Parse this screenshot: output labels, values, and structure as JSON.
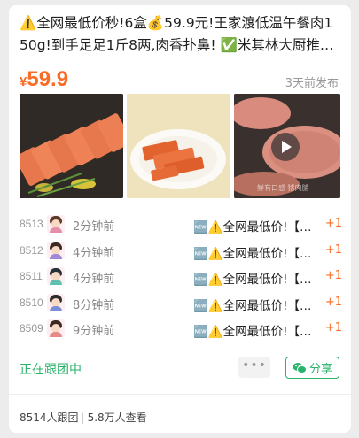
{
  "post": {
    "title": "⚠️全网最低价秒!6盒💰59.9元!王家渡低温午餐肉150g!到手足足1斤8两,肉香扑鼻! ✅米其林大厨推荐,中国十大火腿品牌之一……",
    "price_symbol": "¥",
    "price": "59.9",
    "posted": "3天前发布",
    "photo_watermark": "鲜有口感 猪肉脯"
  },
  "followers": [
    {
      "no": "8513",
      "time": "2分钟前",
      "text": "🆕⚠️全网最低价!【王家渡午餐肉】",
      "plus": "+1",
      "hair": "#5b3a2a",
      "body": "#e58fa8"
    },
    {
      "no": "8512",
      "time": "4分钟前",
      "text": "🆕⚠️全网最低价!【王家渡午餐肉】",
      "plus": "+1",
      "hair": "#3a2a22",
      "body": "#a08ad6"
    },
    {
      "no": "8511",
      "time": "4分钟前",
      "text": "🆕⚠️全网最低价!【王家渡午餐肉】",
      "plus": "+1",
      "hair": "#26323a",
      "body": "#5fc0b0"
    },
    {
      "no": "8510",
      "time": "8分钟前",
      "text": "🆕⚠️全网最低价!【王家渡午餐肉】",
      "plus": "+1",
      "hair": "#2d2d2d",
      "body": "#7a8fd8"
    },
    {
      "no": "8509",
      "time": "9分钟前",
      "text": "🆕⚠️全网最低价!【王家渡午餐肉】",
      "plus": "+1",
      "hair": "#3e2a20",
      "body": "#e98a8a"
    }
  ],
  "actions": {
    "following_label": "正在跟团中",
    "more_label": "•••",
    "share_label": "分享"
  },
  "stats": {
    "joined": "8514人跟团",
    "views": "5.8万人查看"
  },
  "colors": {
    "accent_orange": "#fa6b25",
    "accent_green": "#28b36a"
  }
}
